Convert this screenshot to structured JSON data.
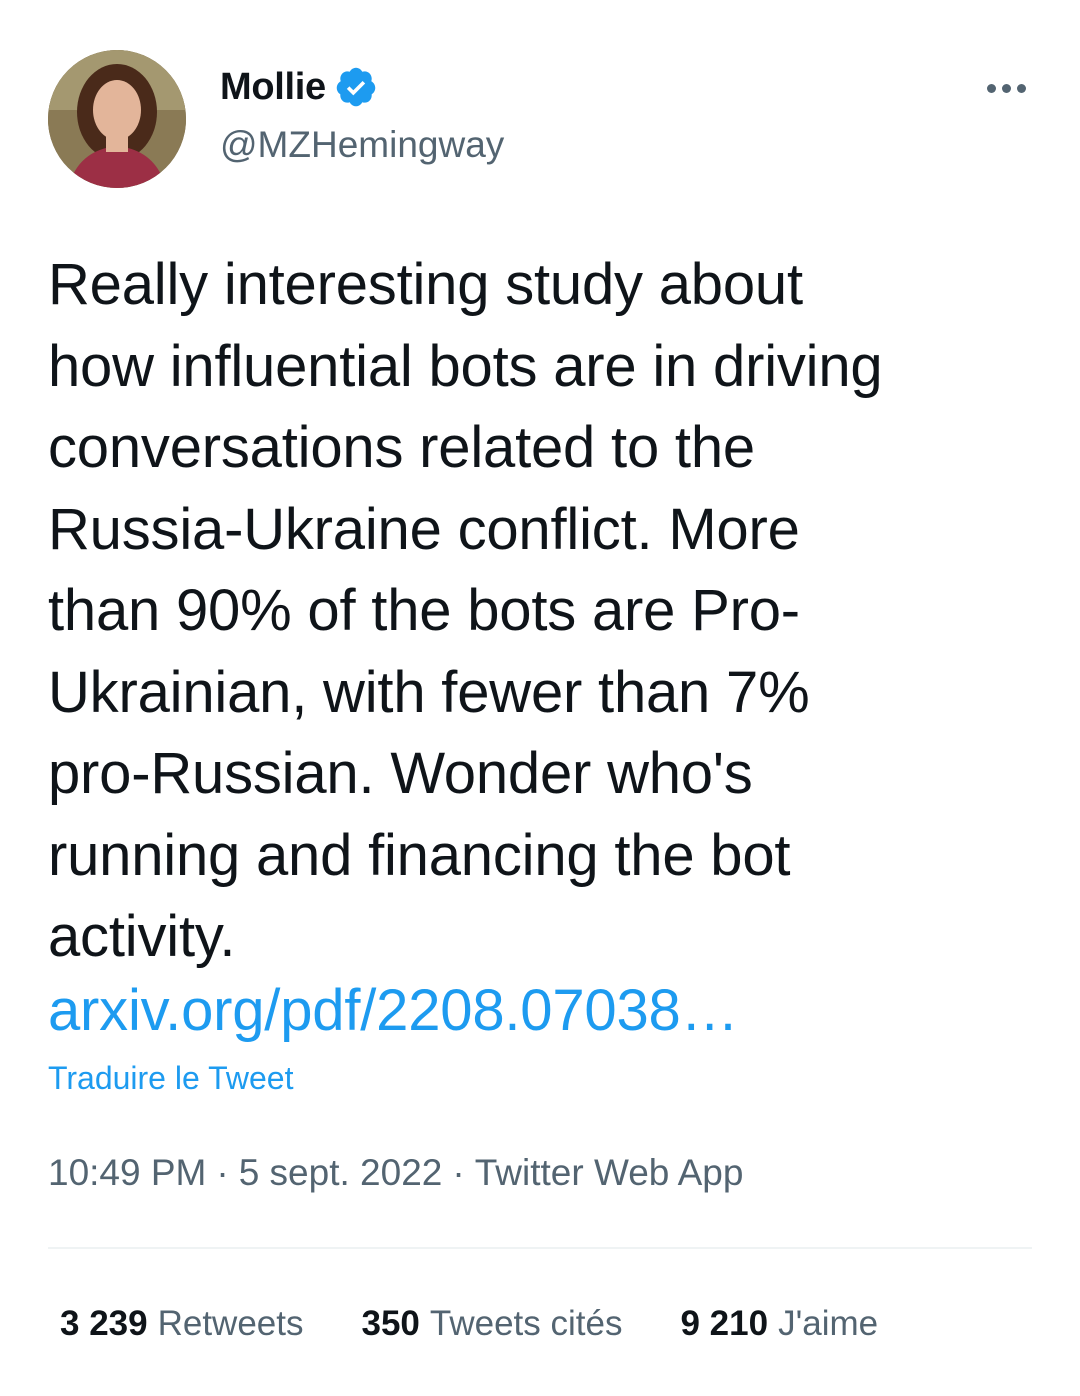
{
  "author": {
    "name": "Mollie",
    "handle": "@MZHemingway",
    "verified_icon": "verified-badge-icon",
    "verified_color": "#1d9bf0"
  },
  "tweet": {
    "text": "Really interesting study about\nhow influential bots are in driving\nconversations related to the\nRussia-Ukraine conflict. More\nthan 90% of the bots are Pro-\nUkrainian, with fewer than 7%\npro-Russian. Wonder who's\nrunning and financing the bot\nactivity.",
    "link": "arxiv.org/pdf/2208.07038…",
    "translate_label": "Traduire le Tweet",
    "time": "10:49 PM",
    "date": "5 sept. 2022",
    "source": "Twitter Web App",
    "separator": "·"
  },
  "stats": [
    {
      "count": "3 239",
      "label": "Retweets"
    },
    {
      "count": "350",
      "label": "Tweets cités"
    },
    {
      "count": "9 210",
      "label": "J'aime"
    }
  ],
  "colors": {
    "link": "#1d9bf0",
    "text": "#0f1419",
    "secondary": "#536471",
    "divider": "#eff3f4"
  }
}
